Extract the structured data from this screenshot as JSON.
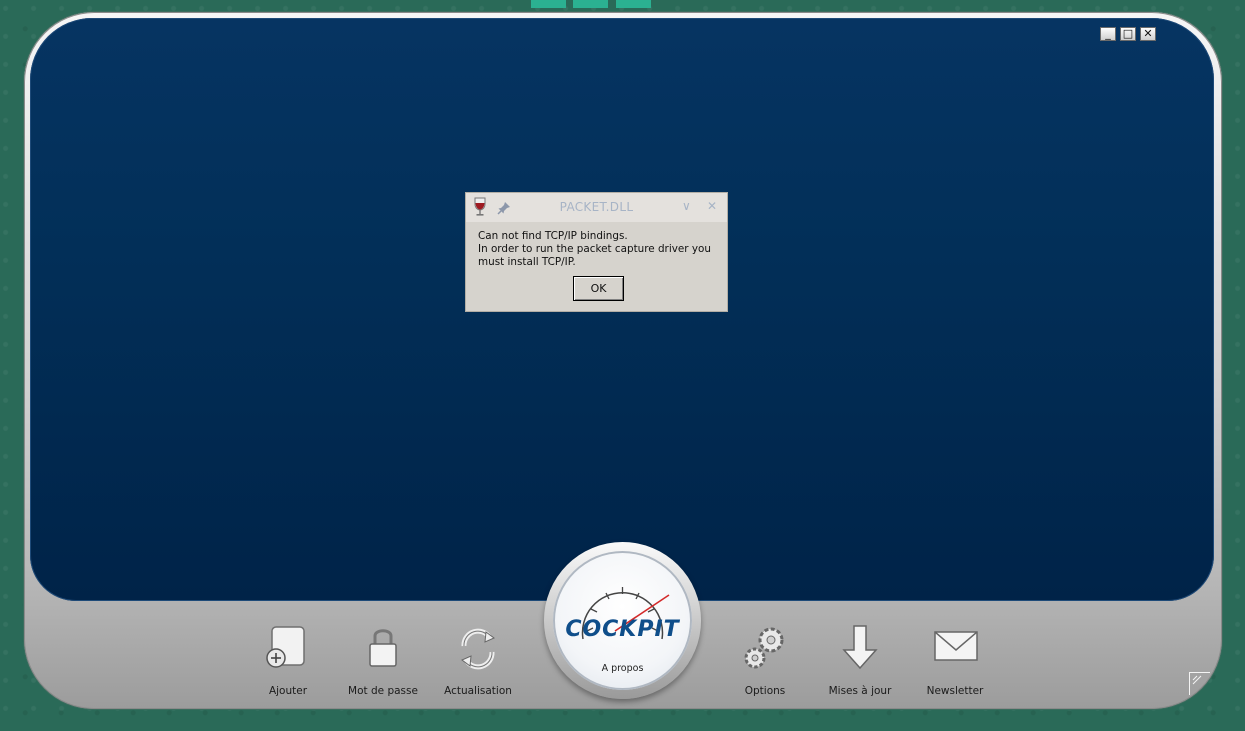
{
  "window_controls": {
    "minimize": "_",
    "maximize": "□",
    "close": "✕"
  },
  "dialog": {
    "title": "PACKET.DLL",
    "message": "Can not find TCP/IP bindings.\nIn order to run the packet capture driver you\nmust install TCP/IP.",
    "ok_label": "OK",
    "chevron": "∨",
    "close": "✕"
  },
  "toolbar": {
    "left": [
      {
        "label": "Ajouter",
        "icon": "add-document-icon"
      },
      {
        "label": "Mot de passe",
        "icon": "padlock-icon"
      },
      {
        "label": "Actualisation",
        "icon": "refresh-icon"
      }
    ],
    "right": [
      {
        "label": "Options",
        "icon": "gears-icon"
      },
      {
        "label": "Mises à jour",
        "icon": "download-arrow-icon"
      },
      {
        "label": "Newsletter",
        "icon": "envelope-icon"
      }
    ]
  },
  "center_logo": {
    "brand": "COCKPIT",
    "caption": "A propos"
  },
  "colors": {
    "screen": "#022f58",
    "frame": "#cfcfcf",
    "background": "#2a6a58",
    "brand_blue": "#0f4e8a",
    "needle": "#d32a2a"
  }
}
